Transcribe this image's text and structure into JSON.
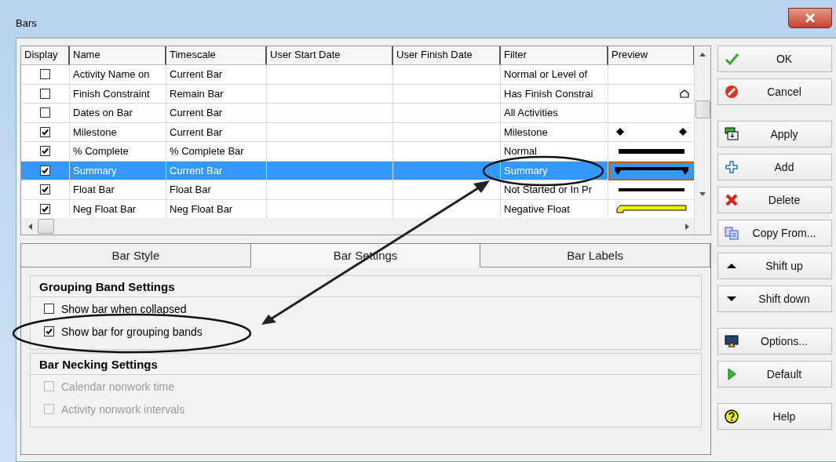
{
  "window": {
    "title": "Bars"
  },
  "table": {
    "columns": [
      "Display",
      "Name",
      "Timescale",
      "User Start Date",
      "User Finish Date",
      "Filter",
      "Preview"
    ],
    "rows": [
      {
        "display": false,
        "name": "Activity Name on",
        "timescale": "Current Bar",
        "filter": "Normal or Level of",
        "kind": "plain",
        "selected": false
      },
      {
        "display": false,
        "name": "Finish Constraint",
        "timescale": "Remain Bar",
        "filter": "Has Finish Constrai",
        "kind": "constraint",
        "selected": false
      },
      {
        "display": false,
        "name": "Dates on Bar",
        "timescale": "Current Bar",
        "filter": "All Activities",
        "kind": "plain",
        "selected": false
      },
      {
        "display": true,
        "name": "Milestone",
        "timescale": "Current Bar",
        "filter": "Milestone",
        "kind": "milestone",
        "selected": false
      },
      {
        "display": true,
        "name": "% Complete",
        "timescale": "% Complete Bar",
        "filter": "Normal",
        "kind": "thick",
        "selected": false
      },
      {
        "display": true,
        "name": "Summary",
        "timescale": "Current Bar",
        "filter": "Summary",
        "kind": "summary",
        "selected": true
      },
      {
        "display": true,
        "name": "Float Bar",
        "timescale": "Float Bar",
        "filter": "Not Started or In Pr",
        "kind": "thin",
        "selected": false
      },
      {
        "display": true,
        "name": "Neg Float Bar",
        "timescale": "Neg Float Bar",
        "filter": "Negative Float",
        "kind": "negfloat",
        "selected": false
      }
    ]
  },
  "tabs": [
    {
      "label": "Bar Style",
      "selected": false
    },
    {
      "label": "Bar Settings",
      "selected": true
    },
    {
      "label": "Bar Labels",
      "selected": false
    }
  ],
  "groups": [
    {
      "title": "Grouping Band Settings",
      "options": [
        {
          "label": "Show bar when collapsed",
          "checked": false,
          "disabled": false
        },
        {
          "label": "Show bar for grouping bands",
          "checked": true,
          "disabled": false
        }
      ]
    },
    {
      "title": "Bar Necking Settings",
      "options": [
        {
          "label": "Calendar nonwork time",
          "checked": false,
          "disabled": true
        },
        {
          "label": "Activity nonwork intervals",
          "checked": false,
          "disabled": true
        }
      ]
    }
  ],
  "button_groups": [
    [
      {
        "label": "OK",
        "kind": "check"
      },
      {
        "label": "Cancel",
        "kind": "cancel"
      }
    ],
    [
      {
        "label": "Apply",
        "kind": "apply"
      },
      {
        "label": "Add",
        "kind": "add"
      },
      {
        "label": "Delete",
        "kind": "delete"
      },
      {
        "label": "Copy From...",
        "kind": "copy"
      },
      {
        "label": "Shift up",
        "kind": "up"
      },
      {
        "label": "Shift down",
        "kind": "down"
      }
    ],
    [
      {
        "label": "Options...",
        "kind": "options"
      },
      {
        "label": "Default",
        "kind": "play"
      }
    ],
    [
      {
        "label": "Help",
        "kind": "help"
      }
    ]
  ],
  "callouts": [
    {
      "kind": "ellipse-filter"
    },
    {
      "kind": "ellipse-option"
    },
    {
      "kind": "arrow"
    }
  ]
}
